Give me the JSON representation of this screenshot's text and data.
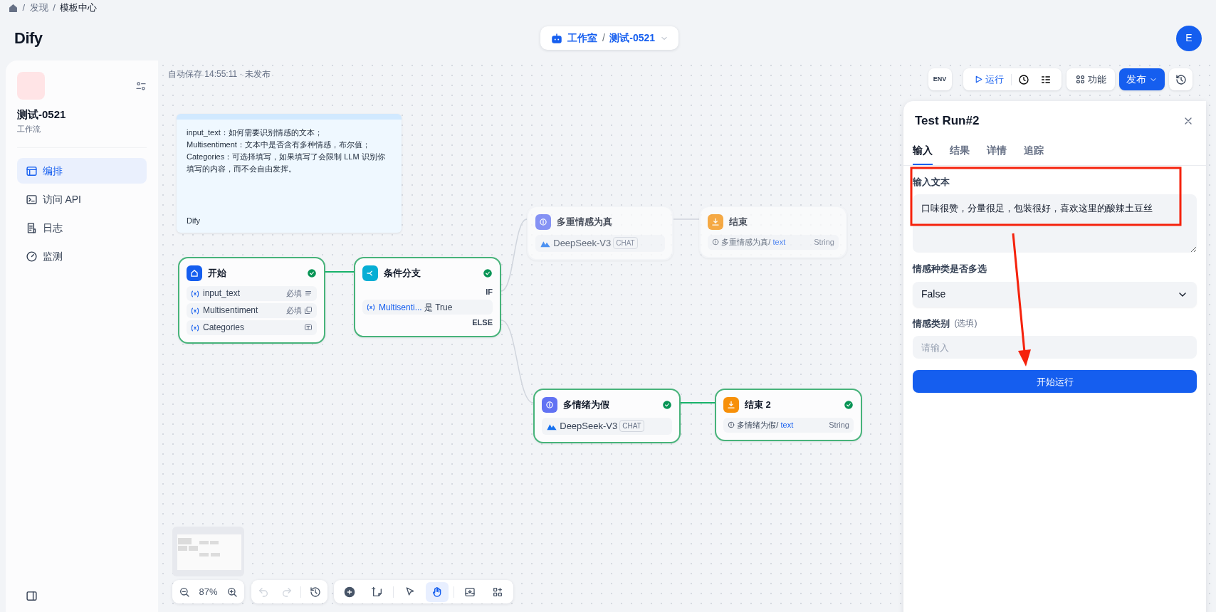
{
  "breadcrumb": {
    "items": [
      "发现",
      "模板中心"
    ],
    "separators": [
      "/",
      "/"
    ]
  },
  "header": {
    "logo": "Dify",
    "workspace": "工作室",
    "separator": "/",
    "app": "测试-0521",
    "avatar": "E"
  },
  "sidebar": {
    "app_name": "测试-0521",
    "app_type": "工作流",
    "items": [
      {
        "label": "编排",
        "selected": true
      },
      {
        "label": "访问 API",
        "selected": false
      },
      {
        "label": "日志",
        "selected": false
      },
      {
        "label": "监测",
        "selected": false
      }
    ]
  },
  "canvas": {
    "autosave": "自动保存 14:55:11 · 未发布",
    "toolbar": {
      "env": "ENV",
      "run": "运行",
      "features": "功能",
      "publish": "发布"
    },
    "note": {
      "lines": [
        "input_text：如何需要识别情感的文本；",
        "Multisentiment：文本中是否含有多种情感，布尔值；",
        "Categories：可选择填写，如果填写了会限制 LLM 识别你填写的内容，而不会自由发挥。"
      ],
      "author": "Dify"
    },
    "nodes": [
      {
        "kind": "start",
        "title": "开始",
        "succeeded": true,
        "variables": [
          {
            "name": "input_text",
            "tag": "必填",
            "kind": "paragraph"
          },
          {
            "name": "Multisentiment",
            "tag": "必填",
            "kind": "select"
          },
          {
            "name": "Categories",
            "kind": "text"
          }
        ]
      },
      {
        "kind": "if-else",
        "title": "条件分支",
        "succeeded": true,
        "if_label": "IF",
        "else_label": "ELSE",
        "condition": {
          "variable": "Multisenti...",
          "operator": "是",
          "value": "True"
        }
      },
      {
        "kind": "llm",
        "title": "多重情感为真",
        "succeeded": false,
        "model": "DeepSeek-V3",
        "mode": "CHAT"
      },
      {
        "kind": "end",
        "title": "结束",
        "succeeded": false,
        "output": {
          "source": "多重情感为真",
          "separator": "/",
          "variable": "text",
          "type": "String"
        }
      },
      {
        "kind": "llm",
        "title": "多情绪为假",
        "succeeded": true,
        "model": "DeepSeek-V3",
        "mode": "CHAT"
      },
      {
        "kind": "end",
        "title": "结束 2",
        "succeeded": true,
        "output": {
          "source": "多情绪为假",
          "separator": "/",
          "variable": "text",
          "type": "String"
        }
      }
    ],
    "zoom": "87%",
    "history": {
      "undo_disabled": true,
      "redo_disabled": true
    },
    "tools": [
      {
        "selected": false
      },
      {
        "selected": false
      },
      {
        "selected": false
      },
      {
        "selected": true
      },
      {
        "selected": false
      },
      {
        "selected": false
      }
    ]
  },
  "panel": {
    "title": "Test Run#2",
    "tabs": [
      {
        "label": "输入",
        "selected": true
      },
      {
        "label": "结果",
        "selected": false
      },
      {
        "label": "详情",
        "selected": false
      },
      {
        "label": "追踪",
        "selected": false
      }
    ],
    "fields": [
      {
        "kind": "textarea",
        "label": "输入文本",
        "value": "口味很赞，分量很足，包装很好，喜欢这里的酸辣土豆丝"
      },
      {
        "kind": "select",
        "label": "情感种类是否多选",
        "value": "False"
      },
      {
        "kind": "input",
        "label": "情感类别",
        "hint": "(选填)",
        "placeholder": "请输入"
      }
    ],
    "button": "开始运行"
  }
}
